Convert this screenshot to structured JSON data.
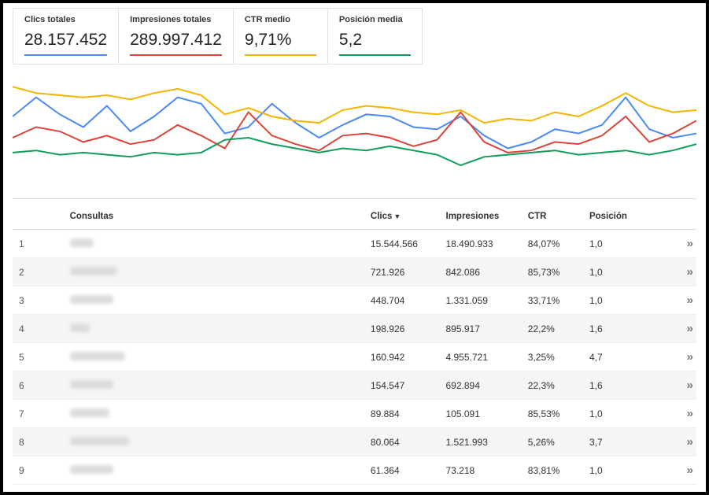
{
  "metrics": [
    {
      "label": "Clics totales",
      "value": "28.157.452",
      "colorClass": "u-blue"
    },
    {
      "label": "Impresiones totales",
      "value": "289.997.412",
      "colorClass": "u-red"
    },
    {
      "label": "CTR medio",
      "value": "9,71%",
      "colorClass": "u-orange"
    },
    {
      "label": "Posición media",
      "value": "5,2",
      "colorClass": "u-green"
    }
  ],
  "chart_data": {
    "type": "line",
    "title": "",
    "xlabel": "",
    "ylabel": "",
    "x": [
      0,
      1,
      2,
      3,
      4,
      5,
      6,
      7,
      8,
      9,
      10,
      11,
      12,
      13,
      14,
      15,
      16,
      17,
      18,
      19,
      20,
      21,
      22,
      23,
      24,
      25,
      26,
      27,
      28,
      29
    ],
    "ylim": [
      0,
      100
    ],
    "series": [
      {
        "name": "Clics totales",
        "color": "#4a8af4",
        "values": [
          60,
          78,
          62,
          50,
          70,
          46,
          60,
          78,
          72,
          44,
          50,
          72,
          54,
          40,
          52,
          62,
          60,
          50,
          48,
          60,
          42,
          30,
          36,
          48,
          44,
          52,
          78,
          48,
          40,
          44
        ]
      },
      {
        "name": "Impresiones totales",
        "color": "#db4437",
        "values": [
          40,
          50,
          46,
          36,
          42,
          34,
          38,
          52,
          42,
          30,
          64,
          42,
          34,
          28,
          42,
          44,
          40,
          32,
          38,
          64,
          36,
          26,
          28,
          36,
          34,
          42,
          60,
          36,
          44,
          56
        ]
      },
      {
        "name": "CTR medio",
        "color": "#f4b400",
        "values": [
          88,
          82,
          80,
          78,
          80,
          76,
          82,
          86,
          80,
          62,
          68,
          60,
          56,
          54,
          66,
          70,
          68,
          64,
          62,
          66,
          54,
          58,
          56,
          64,
          60,
          70,
          82,
          70,
          64,
          66
        ]
      },
      {
        "name": "Posición media",
        "color": "#0f9d58",
        "values": [
          26,
          28,
          24,
          26,
          24,
          22,
          26,
          24,
          26,
          38,
          40,
          34,
          30,
          26,
          30,
          28,
          32,
          28,
          24,
          14,
          22,
          24,
          26,
          28,
          24,
          26,
          28,
          24,
          28,
          34
        ]
      }
    ]
  },
  "table": {
    "headers": {
      "query": "Consultas",
      "clicks": "Clics",
      "impressions": "Impresiones",
      "ctr": "CTR",
      "position": "Posición"
    },
    "sort_indicator": "▼",
    "rows": [
      {
        "idx": "1",
        "blurW": 30,
        "clicks": "15.544.566",
        "impressions": "18.490.933",
        "ctr": "84,07%",
        "position": "1,0"
      },
      {
        "idx": "2",
        "blurW": 60,
        "clicks": "721.926",
        "impressions": "842.086",
        "ctr": "85,73%",
        "position": "1,0"
      },
      {
        "idx": "3",
        "blurW": 55,
        "clicks": "448.704",
        "impressions": "1.331.059",
        "ctr": "33,71%",
        "position": "1,0"
      },
      {
        "idx": "4",
        "blurW": 25,
        "clicks": "198.926",
        "impressions": "895.917",
        "ctr": "22,2%",
        "position": "1,6"
      },
      {
        "idx": "5",
        "blurW": 70,
        "clicks": "160.942",
        "impressions": "4.955.721",
        "ctr": "3,25%",
        "position": "4,7"
      },
      {
        "idx": "6",
        "blurW": 55,
        "clicks": "154.547",
        "impressions": "692.894",
        "ctr": "22,3%",
        "position": "1,6"
      },
      {
        "idx": "7",
        "blurW": 50,
        "clicks": "89.884",
        "impressions": "105.091",
        "ctr": "85,53%",
        "position": "1,0"
      },
      {
        "idx": "8",
        "blurW": 75,
        "clicks": "80.064",
        "impressions": "1.521.993",
        "ctr": "5,26%",
        "position": "3,7"
      },
      {
        "idx": "9",
        "blurW": 55,
        "clicks": "61.364",
        "impressions": "73.218",
        "ctr": "83,81%",
        "position": "1,0"
      }
    ]
  },
  "expand_glyph": "»"
}
